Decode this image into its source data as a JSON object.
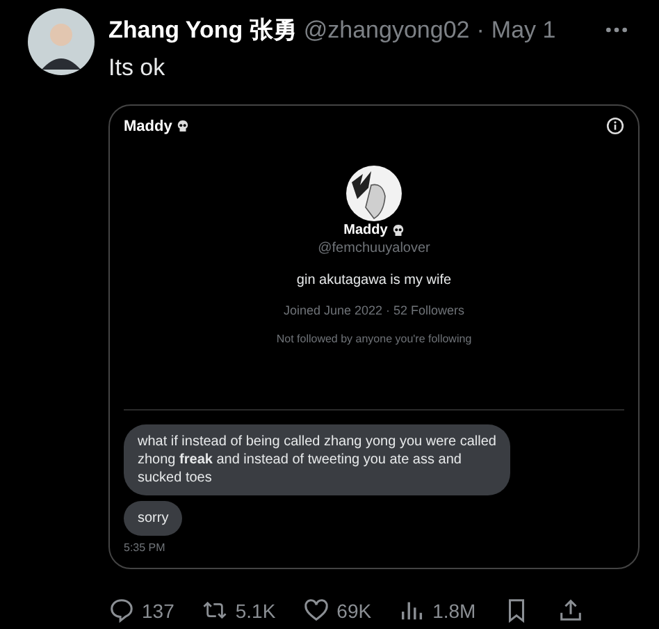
{
  "tweet": {
    "author_name": "Zhang Yong 张勇",
    "handle": "@zhangyong02",
    "separator": "·",
    "date": "May 1",
    "text": "Its ok"
  },
  "embedded_screenshot": {
    "header_name": "Maddy",
    "profile": {
      "name": "Maddy",
      "handle": "@femchuuyalover",
      "bio": "gin akutagawa is my wife",
      "joined": "Joined June 2022 · 52 Followers",
      "mutuals": "Not followed by anyone you're following"
    },
    "messages": [
      {
        "text": "what if instead of being called zhang yong you were called zhong **freak** and instead of tweeting you ate ass and sucked toes"
      },
      {
        "text": "sorry"
      }
    ],
    "time": "5:35 PM"
  },
  "actions": [
    {
      "kind": "reply",
      "count": "137"
    },
    {
      "kind": "retweet",
      "count": "5.1K"
    },
    {
      "kind": "like",
      "count": "69K"
    },
    {
      "kind": "views",
      "count": "1.8M"
    },
    {
      "kind": "bookmark"
    },
    {
      "kind": "share"
    }
  ]
}
